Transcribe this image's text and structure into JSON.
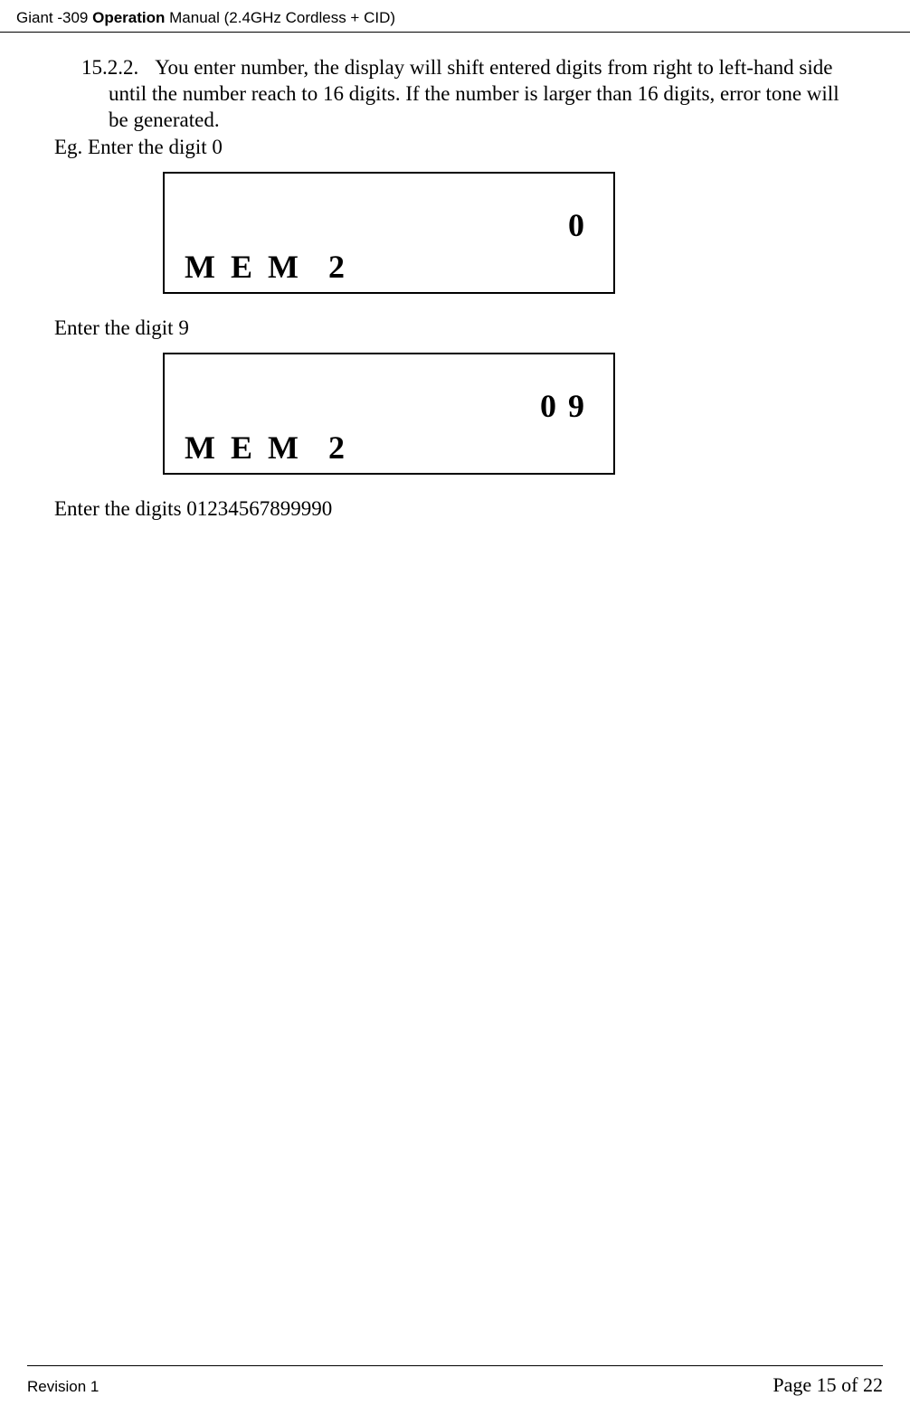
{
  "header": {
    "product_prefix": "Giant -309  ",
    "title_bold": "Operation",
    "title_rest": " Manual (2.4GHz Cordless + CID)"
  },
  "section": {
    "num": "15.2.2.",
    "text_line1": "You enter number, the display will shift entered digits from right to left-hand side",
    "text_line2": "until the number reach to 16 digits.  If the number is larger than 16 digits, error tone will",
    "text_line3": "be generated."
  },
  "eg_line": "Eg. Enter the digit  0",
  "display1": {
    "digits": "0",
    "mem_label": "M E M",
    "mem_num": "2"
  },
  "enter_line2": "Enter the digit  9",
  "display2": {
    "digits": "0  9",
    "mem_label": "M E M",
    "mem_num": "2"
  },
  "enter_line3": "Enter the digits 01234567899990",
  "footer": {
    "revision": "Revision 1",
    "page": "Page 15 of 22"
  }
}
